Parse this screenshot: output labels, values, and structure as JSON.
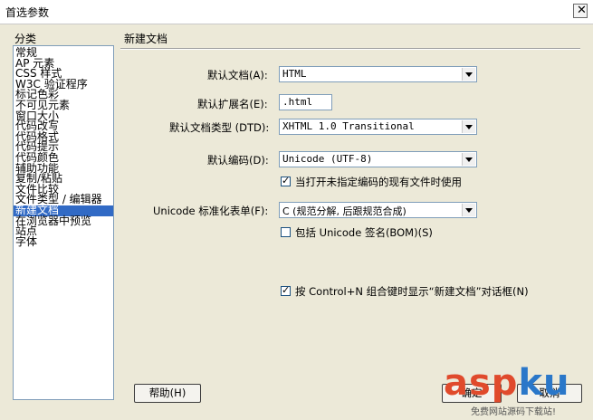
{
  "window": {
    "title": "首选参数"
  },
  "sidebar": {
    "label": "分类",
    "items": [
      "常规",
      "AP 元素",
      "CSS 样式",
      "W3C 验证程序",
      "标记色彩",
      "不可见元素",
      "窗口大小",
      "代码改写",
      "代码格式",
      "代码提示",
      "代码颜色",
      "辅助功能",
      "复制/粘贴",
      "文件比较",
      "文件类型 / 编辑器",
      "新建文档",
      "在浏览器中预览",
      "站点",
      "字体"
    ],
    "selected_index": 15
  },
  "panel": {
    "title": "新建文档",
    "default_doc_label": "默认文档(A):",
    "default_doc_value": "HTML",
    "default_ext_label": "默认扩展名(E):",
    "default_ext_value": ".html",
    "doctype_label": "默认文档类型 (DTD):",
    "doctype_value": "XHTML 1.0 Transitional",
    "encoding_label": "默认编码(D):",
    "encoding_value": "Unicode (UTF-8)",
    "use_encoding_label": "当打开未指定编码的现有文件时使用",
    "use_encoding_checked": true,
    "normalize_label": "Unicode 标准化表单(F):",
    "normalize_value": "C (规范分解, 后跟规范合成)",
    "bom_label": "包括 Unicode 签名(BOM)(S)",
    "bom_checked": false,
    "ctrl_n_label": "按 Control+N 组合键时显示“新建文档”对话框(N)",
    "ctrl_n_checked": true
  },
  "buttons": {
    "help": "帮助(H)",
    "ok": "确定",
    "cancel": "取消"
  },
  "watermark": {
    "logo_asp": "asp",
    "logo_ku": "ku",
    "sub": "免费网站源码下载站!"
  }
}
